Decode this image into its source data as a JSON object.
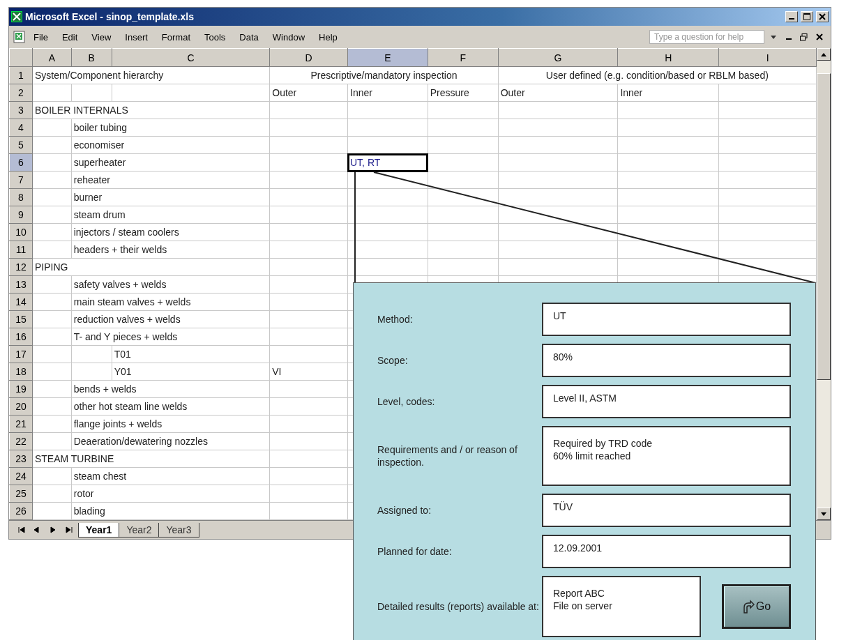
{
  "window": {
    "title": "Microsoft Excel - sinop_template.xls"
  },
  "menu": [
    {
      "label": "File"
    },
    {
      "label": "Edit"
    },
    {
      "label": "View"
    },
    {
      "label": "Insert"
    },
    {
      "label": "Format"
    },
    {
      "label": "Tools"
    },
    {
      "label": "Data"
    },
    {
      "label": "Window"
    },
    {
      "label": "Help"
    }
  ],
  "help_search": {
    "placeholder": "Type a question for help"
  },
  "columns": [
    {
      "label": "A",
      "selected": false
    },
    {
      "label": "B",
      "selected": false
    },
    {
      "label": "C",
      "selected": false
    },
    {
      "label": "D",
      "selected": false
    },
    {
      "label": "E",
      "selected": true
    },
    {
      "label": "F",
      "selected": false
    },
    {
      "label": "G",
      "selected": false
    },
    {
      "label": "H",
      "selected": false
    },
    {
      "label": "I",
      "selected": false
    }
  ],
  "group_header_row": {
    "number": "1",
    "groups": [
      "System/Component hierarchy",
      "Prescriptive/mandatory inspection",
      "User defined (e.g. condition/based or RBLM based)"
    ]
  },
  "sub_header_row": {
    "number": "2",
    "prescriptive": [
      "Outer",
      "Inner",
      "Pressure"
    ],
    "user_defined": [
      "Outer",
      "Inner"
    ]
  },
  "hierarchy": [
    {
      "number": "3",
      "label": "BOILER INTERNALS",
      "selected": false,
      "children": [
        {
          "number": "4",
          "label": "boiler tubing",
          "selected": false
        },
        {
          "number": "5",
          "label": "economiser",
          "selected": false
        },
        {
          "number": "6",
          "label": "superheater",
          "selected": true,
          "inner": "UT, RT"
        },
        {
          "number": "7",
          "label": "reheater",
          "selected": false
        },
        {
          "number": "8",
          "label": "burner",
          "selected": false
        },
        {
          "number": "9",
          "label": "steam drum",
          "selected": false
        },
        {
          "number": "10",
          "label": "injectors / steam coolers",
          "selected": false
        },
        {
          "number": "11",
          "label": "headers + their welds",
          "selected": false
        }
      ]
    },
    {
      "number": "12",
      "label": "PIPING",
      "selected": false,
      "children": [
        {
          "number": "13",
          "label": "safety valves + welds",
          "selected": false
        },
        {
          "number": "14",
          "label": "main steam valves + welds",
          "selected": false
        },
        {
          "number": "15",
          "label": "reduction valves + welds",
          "selected": false
        },
        {
          "number": "16",
          "label": "T- and Y pieces + welds",
          "selected": false,
          "children": [
            {
              "number": "17",
              "label": "T01",
              "selected": false
            },
            {
              "number": "18",
              "label": "Y01",
              "selected": false,
              "outer": "VI"
            }
          ]
        },
        {
          "number": "19",
          "label": "bends + welds",
          "selected": false
        },
        {
          "number": "20",
          "label": "other hot steam line welds",
          "selected": false
        },
        {
          "number": "21",
          "label": "flange joints + welds",
          "selected": false
        },
        {
          "number": "22",
          "label": "Deaeration/dewatering nozzles",
          "selected": false
        }
      ]
    },
    {
      "number": "23",
      "label": "STEAM TURBINE",
      "selected": false,
      "children": [
        {
          "number": "24",
          "label": "steam chest",
          "selected": false
        },
        {
          "number": "25",
          "label": "rotor",
          "selected": false
        },
        {
          "number": "26",
          "label": "blading",
          "selected": false
        }
      ]
    }
  ],
  "sheet_tabs": [
    {
      "label": "Year1",
      "selected": true
    },
    {
      "label": "Year2",
      "selected": false
    },
    {
      "label": "Year3",
      "selected": false
    }
  ],
  "inspection_panel": {
    "fields": [
      {
        "label": "Method:",
        "value": "UT",
        "kind": "single"
      },
      {
        "label": "Scope:",
        "value": "80%",
        "kind": "single"
      },
      {
        "label": "Level, codes:",
        "value": "Level II, ASTM",
        "kind": "single"
      },
      {
        "label": "Requirements and / or reason of inspection.",
        "value": "Required by TRD code\n60% limit reached",
        "kind": "multi"
      },
      {
        "label": "Assigned to:",
        "value": "TÜV",
        "kind": "single"
      },
      {
        "label": "Planned for date:",
        "value": "12.09.2001",
        "kind": "single"
      },
      {
        "label": "Detailed results (reports) available at:",
        "value": "Report ABC\nFile on server",
        "kind": "link"
      }
    ],
    "go_button": "Go"
  }
}
